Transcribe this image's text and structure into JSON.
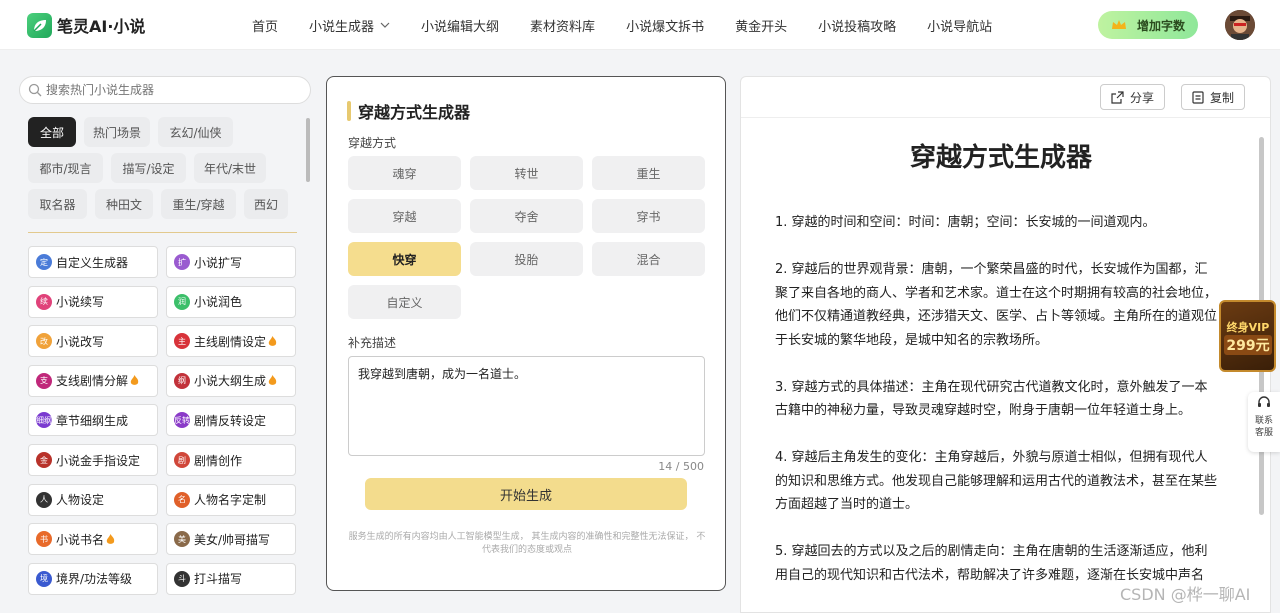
{
  "app": {
    "name": "笔灵AI·小说"
  },
  "nav": {
    "items": [
      "首页",
      "小说生成器",
      "小说编辑大纲",
      "素材资料库",
      "小说爆文拆书",
      "黄金开头",
      "小说投稿攻略",
      "小说导航站"
    ],
    "add_button": "增加字数"
  },
  "sidebar": {
    "search_placeholder": "搜索热门小说生成器",
    "categories": [
      "全部",
      "热门场景",
      "玄幻/仙侠",
      "都市/现言",
      "描写/设定",
      "年代/末世",
      "取名器",
      "种田文",
      "重生/穿越",
      "西幻"
    ],
    "active_category": "全部",
    "tools": [
      {
        "label": "自定义生成器",
        "icon": "定",
        "color": "#4a7bd8",
        "hot": false
      },
      {
        "label": "小说扩写",
        "icon": "扩",
        "color": "#9a5bd0",
        "hot": false
      },
      {
        "label": "小说续写",
        "icon": "续",
        "color": "#e0427a",
        "hot": false
      },
      {
        "label": "小说润色",
        "icon": "润",
        "color": "#3cbf6a",
        "hot": false
      },
      {
        "label": "小说改写",
        "icon": "改",
        "color": "#f0a23a",
        "hot": false
      },
      {
        "label": "主线剧情设定",
        "icon": "主",
        "color": "#d8333a",
        "hot": true
      },
      {
        "label": "支线剧情分解",
        "icon": "支",
        "color": "#c0287a",
        "hot": true
      },
      {
        "label": "小说大纲生成",
        "icon": "纲",
        "color": "#c2323a",
        "hot": true
      },
      {
        "label": "章节细纲生成",
        "icon": "细纲",
        "color": "#7a3ad0",
        "hot": false
      },
      {
        "label": "剧情反转设定",
        "icon": "反转",
        "color": "#8a3ac8",
        "hot": false
      },
      {
        "label": "小说金手指设定",
        "icon": "金",
        "color": "#b8322a",
        "hot": false
      },
      {
        "label": "剧情创作",
        "icon": "剧",
        "color": "#d0473a",
        "hot": false
      },
      {
        "label": "人物设定",
        "icon": "人",
        "color": "#333333",
        "hot": false
      },
      {
        "label": "人物名字定制",
        "icon": "名",
        "color": "#e0602a",
        "hot": false
      },
      {
        "label": "小说书名",
        "icon": "书",
        "color": "#e86a2a",
        "hot": true
      },
      {
        "label": "美女/帅哥描写",
        "icon": "美",
        "color": "#8a6a4a",
        "hot": false
      },
      {
        "label": "境界/功法等级",
        "icon": "境",
        "color": "#3a5ad0",
        "hot": false
      },
      {
        "label": "打斗描写",
        "icon": "斗",
        "color": "#333333",
        "hot": false
      }
    ]
  },
  "generator": {
    "title": "穿越方式生成器",
    "option_label": "穿越方式",
    "options": [
      "魂穿",
      "转世",
      "重生",
      "穿越",
      "夺舍",
      "穿书",
      "快穿",
      "投胎",
      "混合",
      "自定义"
    ],
    "selected_option": "快穿",
    "extra_label": "补充描述",
    "extra_value": "我穿越到唐朝，成为一名道士。",
    "char_count": "14 / 500",
    "generate_button": "开始生成",
    "disclaimer": "服务生成的所有内容均由人工智能模型生成， 其生成内容的准确性和完整性无法保证， 不代表我们的态度或观点"
  },
  "result": {
    "share_button": "分享",
    "copy_button": "复制",
    "title": "穿越方式生成器",
    "paragraphs": [
      "1. 穿越的时间和空间：时间：唐朝；空间：长安城的一间道观内。",
      "2. 穿越后的世界观背景：唐朝，一个繁荣昌盛的时代，长安城作为国都，汇聚了来自各地的商人、学者和艺术家。道士在这个时期拥有较高的社会地位，他们不仅精通道教经典，还涉猎天文、医学、占卜等领域。主角所在的道观位于长安城的繁华地段，是城中知名的宗教场所。",
      "3. 穿越方式的具体描述：主角在现代研究古代道教文化时，意外触发了一本古籍中的神秘力量，导致灵魂穿越时空，附身于唐朝一位年轻道士身上。",
      "4. 穿越后主角发生的变化：主角穿越后，外貌与原道士相似，但拥有现代人的知识和思维方式。他发现自己能够理解和运用古代的道教法术，甚至在某些方面超越了当时的道士。",
      "5. 穿越回去的方式以及之后的剧情走向：主角在唐朝的生活逐渐适应，他利用自己的现代知识和古代法术，帮助解决了许多难题，逐渐在长安城中声名"
    ]
  },
  "floating": {
    "vip_line1": "终身VIP",
    "vip_line2": "299元",
    "contact": "联系客服"
  },
  "watermark": "CSDN @桦一聊AI"
}
